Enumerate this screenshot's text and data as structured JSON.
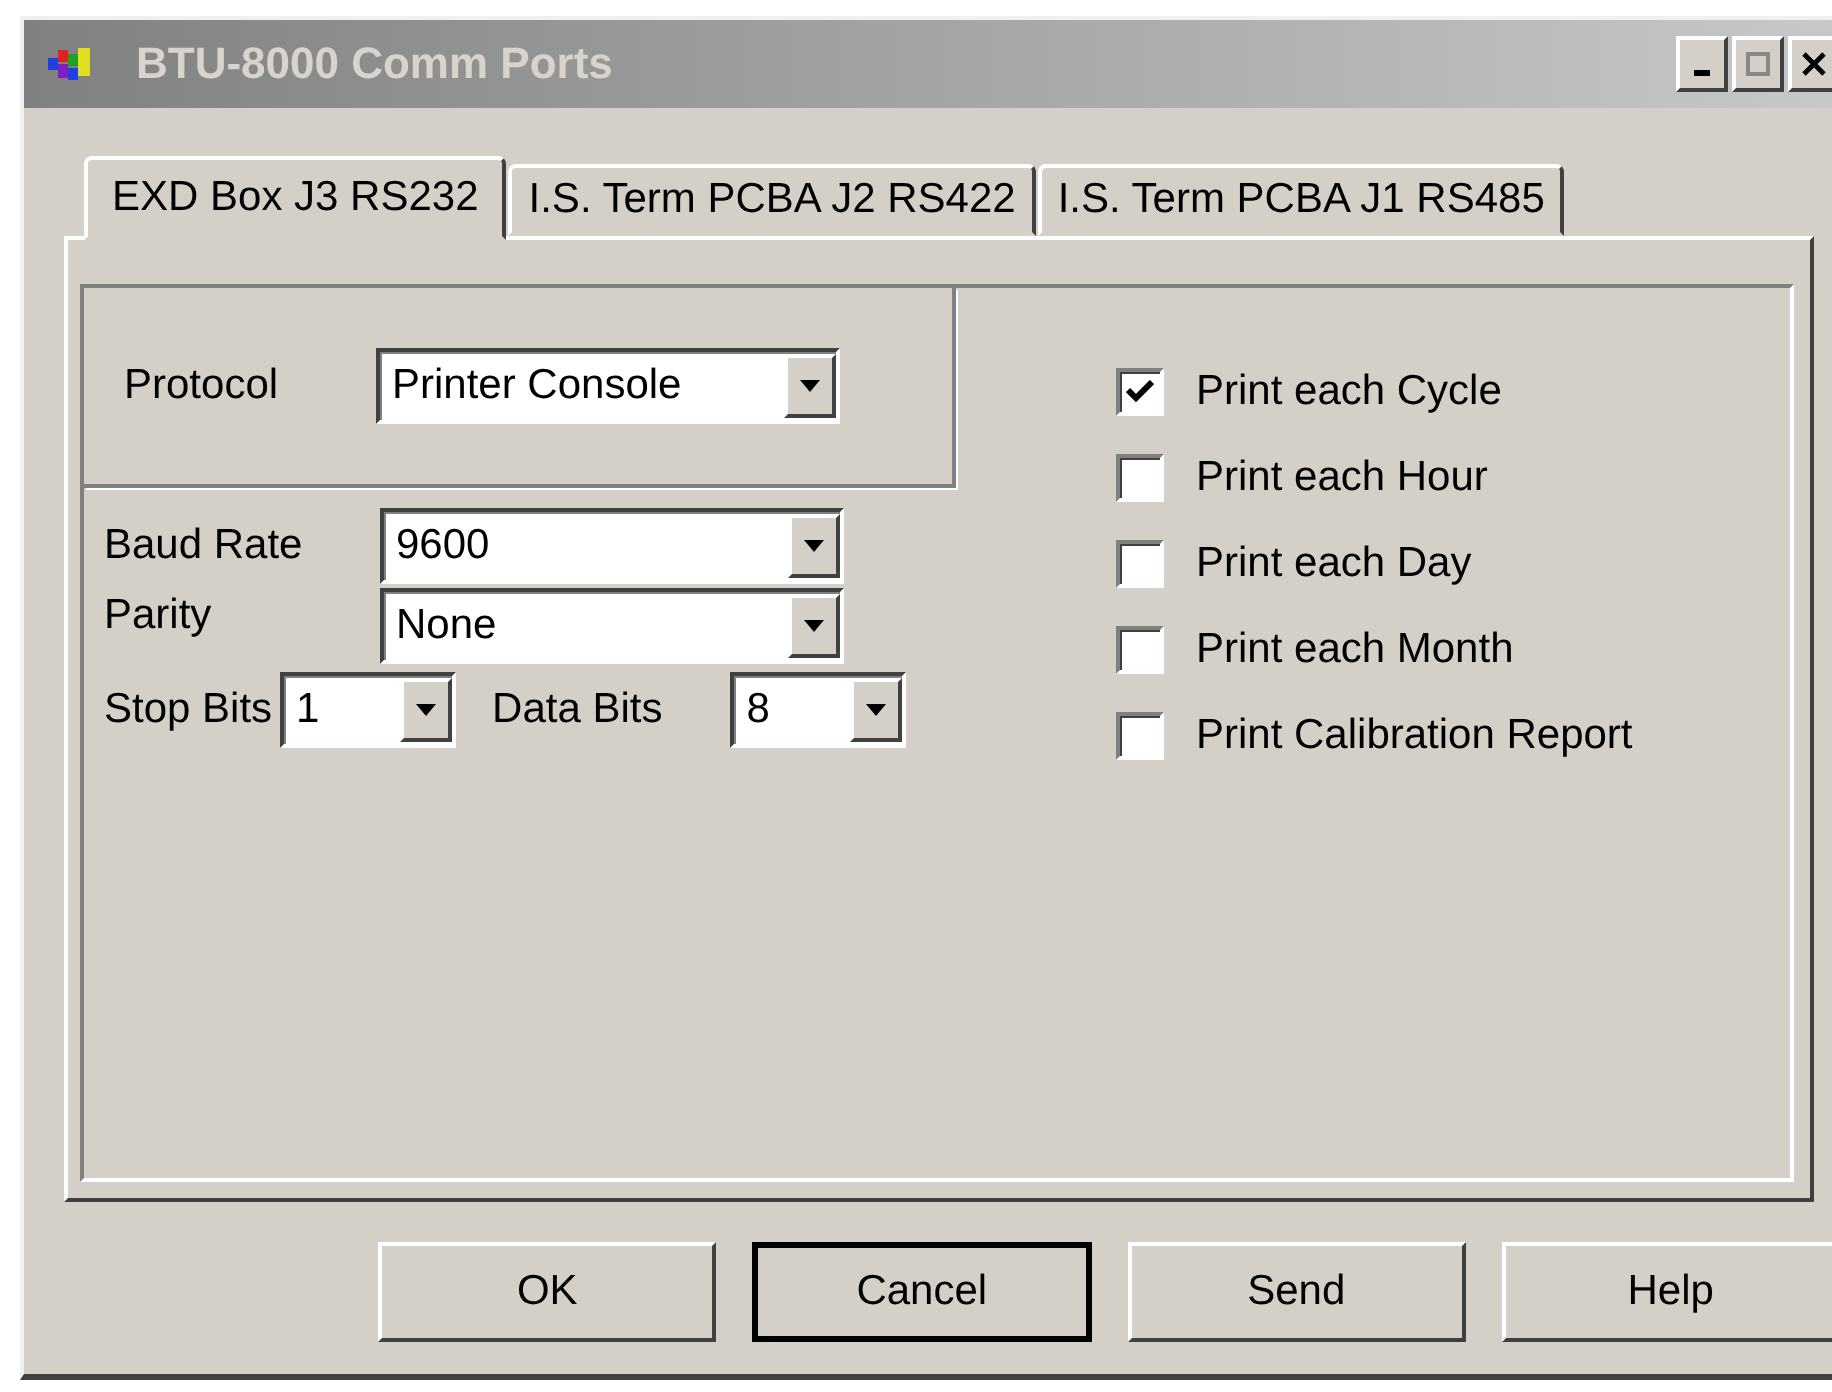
{
  "window": {
    "title": "BTU-8000 Comm Ports"
  },
  "tabs": [
    {
      "label": "EXD Box J3 RS232",
      "selected": true
    },
    {
      "label": "I.S. Term PCBA J2 RS422",
      "selected": false
    },
    {
      "label": "I.S. Term PCBA J1 RS485",
      "selected": false
    }
  ],
  "protocol": {
    "label": "Protocol",
    "value": "Printer Console"
  },
  "baud_rate": {
    "label": "Baud Rate",
    "value": "9600"
  },
  "parity": {
    "label": "Parity",
    "value": "None"
  },
  "stop_bits": {
    "label": "Stop Bits",
    "value": "1"
  },
  "data_bits": {
    "label": "Data Bits",
    "value": "8"
  },
  "options": [
    {
      "label": "Print each Cycle",
      "checked": true
    },
    {
      "label": "Print each Hour",
      "checked": false
    },
    {
      "label": "Print each Day",
      "checked": false
    },
    {
      "label": "Print each Month",
      "checked": false
    },
    {
      "label": "Print Calibration Report",
      "checked": false
    }
  ],
  "buttons": [
    {
      "label": "OK",
      "default": false
    },
    {
      "label": "Cancel",
      "default": true
    },
    {
      "label": "Send",
      "default": false
    },
    {
      "label": "Help",
      "default": false
    }
  ]
}
